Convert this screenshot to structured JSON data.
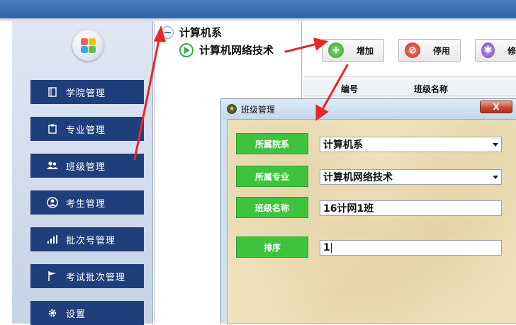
{
  "sidebar": {
    "items": [
      {
        "label": "学院管理",
        "icon": "book-icon"
      },
      {
        "label": "专业管理",
        "icon": "clipboard-icon"
      },
      {
        "label": "班级管理",
        "icon": "users-icon"
      },
      {
        "label": "考生管理",
        "icon": "user-circle-icon"
      },
      {
        "label": "批次号管理",
        "icon": "signal-bars-icon"
      },
      {
        "label": "考试批次管理",
        "icon": "flag-icon"
      },
      {
        "label": "设置",
        "icon": "gear-icon"
      }
    ]
  },
  "tree": {
    "root": {
      "label": "计算机系",
      "icon": "minus-circle-icon"
    },
    "child": {
      "label": "计算机网络技术",
      "icon": "play-circle-icon"
    }
  },
  "toolbar": {
    "add_label": "增加",
    "disable_label": "停用",
    "third_label": "修"
  },
  "grid": {
    "columns": [
      "编号",
      "班级名称"
    ]
  },
  "dialog": {
    "title": "班级管理",
    "close_label": "X",
    "fields": {
      "department_label": "所属院系",
      "department_value": "计算机系",
      "major_label": "所属专业",
      "major_value": "计算机网络技术",
      "class_name_label": "班级名称",
      "class_name_value": "16计网1班",
      "sort_label": "排序",
      "sort_value": "1"
    }
  },
  "colors": {
    "nav_bg": "#1f3e7c",
    "label_green": "#3ec33e",
    "arrow_red": "#e8262b"
  }
}
